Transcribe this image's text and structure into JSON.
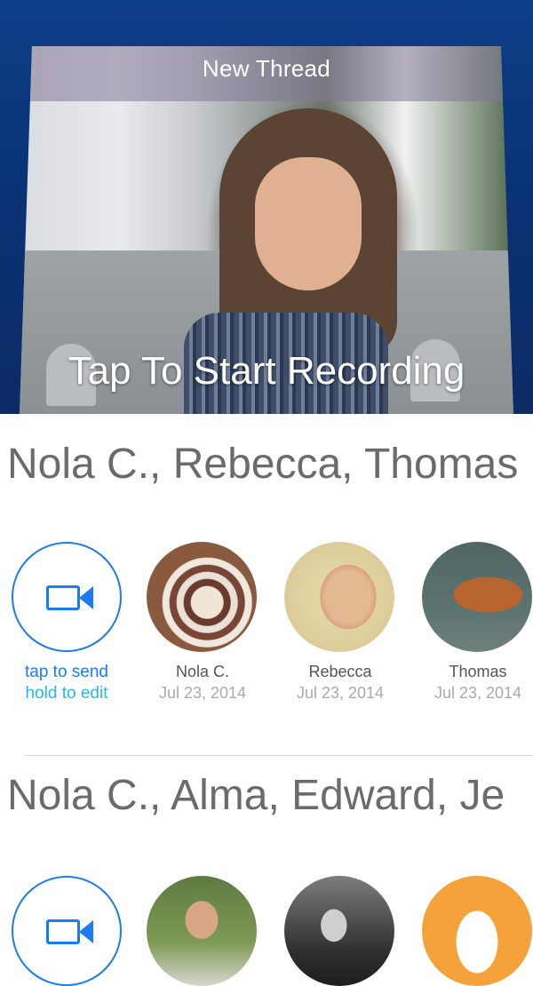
{
  "hero": {
    "title": "New Thread",
    "cta": "Tap To Start Recording"
  },
  "threads": [
    {
      "title": "Nola C., Rebecca, Thomas",
      "send_label": "tap to send",
      "edit_label": "hold to edit",
      "participants": [
        {
          "name": "Nola C.",
          "date": "Jul 23, 2014"
        },
        {
          "name": "Rebecca",
          "date": "Jul 23, 2014"
        },
        {
          "name": "Thomas",
          "date": "Jul 23, 2014"
        }
      ]
    },
    {
      "title": "Nola C., Alma, Edward, Je"
    }
  ],
  "colors": {
    "accent_blue": "#1a7cf0",
    "hold_edit_cyan": "#29b6f0",
    "hero_background": "#0b3a80",
    "orange_avatar": "#f5a23a"
  },
  "icons": [
    "video-camera-icon"
  ]
}
